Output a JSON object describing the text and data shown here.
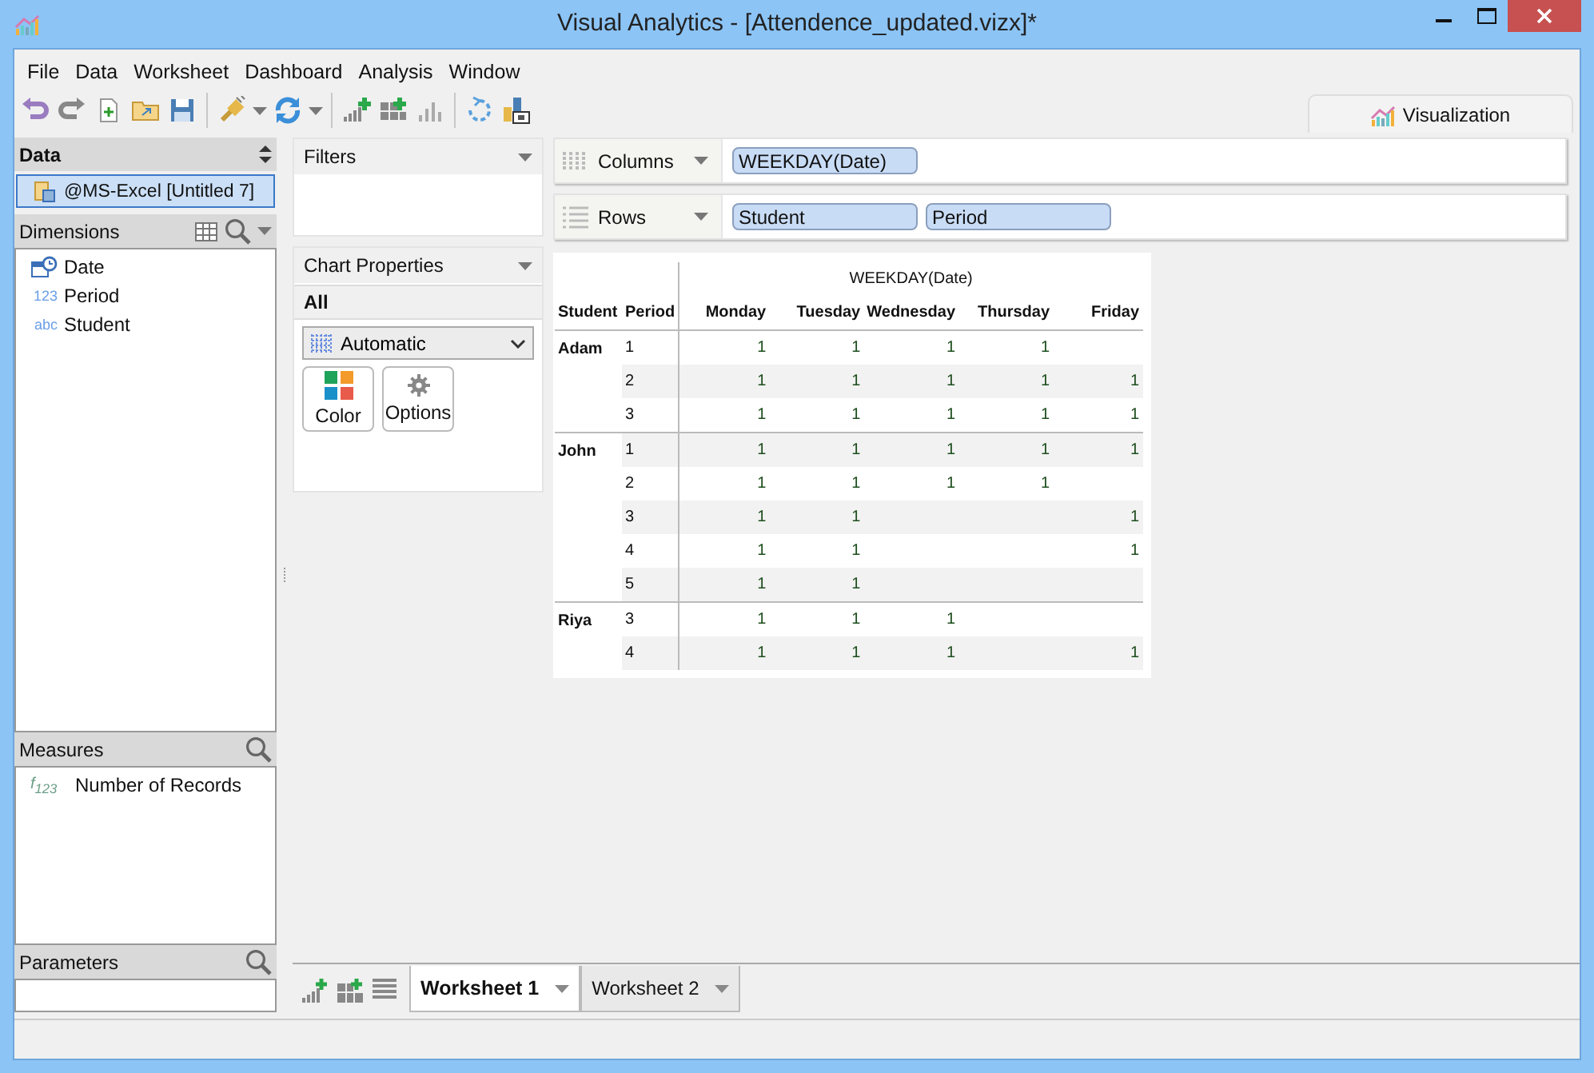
{
  "window": {
    "title": "Visual Analytics - [Attendence_updated.vizx]*"
  },
  "menu": [
    "File",
    "Data",
    "Worksheet",
    "Dashboard",
    "Analysis",
    "Window"
  ],
  "visualization_tab": {
    "label": "Visualization"
  },
  "data_panel": {
    "title": "Data",
    "sources": [
      {
        "label": "@MS-Excel [Untitled 7]",
        "selected": true
      }
    ]
  },
  "dimensions": {
    "title": "Dimensions",
    "items": [
      {
        "kind": "date",
        "label": "Date"
      },
      {
        "kind": "number",
        "type_label": "123",
        "label": "Period"
      },
      {
        "kind": "text",
        "type_label": "abc",
        "label": "Student"
      }
    ]
  },
  "measures": {
    "title": "Measures",
    "items": [
      {
        "type_label": "f$_{123}$",
        "label": "Number of Records"
      }
    ]
  },
  "parameters": {
    "title": "Parameters"
  },
  "filters": {
    "title": "Filters"
  },
  "chart_properties": {
    "title": "Chart Properties",
    "scope": "All",
    "mark_type": "Automatic",
    "buttons": [
      {
        "kind": "color",
        "label": "Color"
      },
      {
        "kind": "options",
        "label": "Options"
      }
    ]
  },
  "shelves": [
    {
      "kind": "columns",
      "label": "Columns",
      "pills": [
        "WEEKDAY(Date)"
      ]
    },
    {
      "kind": "rows",
      "label": "Rows",
      "pills": [
        "Student",
        "Period"
      ]
    }
  ],
  "table": {
    "title": "WEEKDAY(Date)",
    "row_headers": [
      "Student",
      "Period"
    ],
    "columns": [
      "Monday",
      "Tuesday",
      "Wednesday",
      "Thursday",
      "Friday"
    ],
    "groups": [
      {
        "student": "Adam",
        "rows": [
          {
            "period": "1",
            "cells": [
              {
                "kind": "value",
                "text": "1"
              },
              {
                "kind": "value",
                "text": "1"
              },
              {
                "kind": "value",
                "text": "1"
              },
              {
                "kind": "value",
                "text": "1"
              },
              {
                "kind": "empty"
              }
            ]
          },
          {
            "period": "2",
            "cells": [
              {
                "kind": "value",
                "text": "1"
              },
              {
                "kind": "value",
                "text": "1"
              },
              {
                "kind": "value",
                "text": "1"
              },
              {
                "kind": "value",
                "text": "1"
              },
              {
                "kind": "value",
                "text": "1"
              }
            ]
          },
          {
            "period": "3",
            "cells": [
              {
                "kind": "value",
                "text": "1"
              },
              {
                "kind": "value",
                "text": "1"
              },
              {
                "kind": "value",
                "text": "1"
              },
              {
                "kind": "value",
                "text": "1"
              },
              {
                "kind": "value",
                "text": "1"
              }
            ]
          }
        ]
      },
      {
        "student": "John",
        "rows": [
          {
            "period": "1",
            "cells": [
              {
                "kind": "value",
                "text": "1"
              },
              {
                "kind": "value",
                "text": "1"
              },
              {
                "kind": "value",
                "text": "1"
              },
              {
                "kind": "value",
                "text": "1"
              },
              {
                "kind": "value",
                "text": "1"
              }
            ]
          },
          {
            "period": "2",
            "cells": [
              {
                "kind": "value",
                "text": "1"
              },
              {
                "kind": "value",
                "text": "1"
              },
              {
                "kind": "value",
                "text": "1"
              },
              {
                "kind": "value",
                "text": "1"
              },
              {
                "kind": "empty"
              }
            ]
          },
          {
            "period": "3",
            "cells": [
              {
                "kind": "value",
                "text": "1"
              },
              {
                "kind": "value",
                "text": "1"
              },
              {
                "kind": "empty"
              },
              {
                "kind": "empty"
              },
              {
                "kind": "value",
                "text": "1"
              }
            ]
          },
          {
            "period": "4",
            "cells": [
              {
                "kind": "value",
                "text": "1"
              },
              {
                "kind": "value",
                "text": "1"
              },
              {
                "kind": "empty"
              },
              {
                "kind": "empty"
              },
              {
                "kind": "value",
                "text": "1"
              }
            ]
          },
          {
            "period": "5",
            "cells": [
              {
                "kind": "value",
                "text": "1"
              },
              {
                "kind": "value",
                "text": "1"
              },
              {
                "kind": "empty"
              },
              {
                "kind": "empty"
              },
              {
                "kind": "empty"
              }
            ]
          }
        ]
      },
      {
        "student": "Riya",
        "rows": [
          {
            "period": "3",
            "cells": [
              {
                "kind": "value",
                "text": "1"
              },
              {
                "kind": "value",
                "text": "1"
              },
              {
                "kind": "value",
                "text": "1"
              },
              {
                "kind": "empty"
              },
              {
                "kind": "empty"
              }
            ]
          },
          {
            "period": "4",
            "cells": [
              {
                "kind": "value",
                "text": "1"
              },
              {
                "kind": "value",
                "text": "1"
              },
              {
                "kind": "value",
                "text": "1"
              },
              {
                "kind": "empty"
              },
              {
                "kind": "value",
                "text": "1"
              }
            ]
          }
        ]
      }
    ]
  },
  "sheets": [
    {
      "label": "Worksheet 1",
      "selected": true
    },
    {
      "label": "Worksheet 2",
      "selected": false
    }
  ]
}
